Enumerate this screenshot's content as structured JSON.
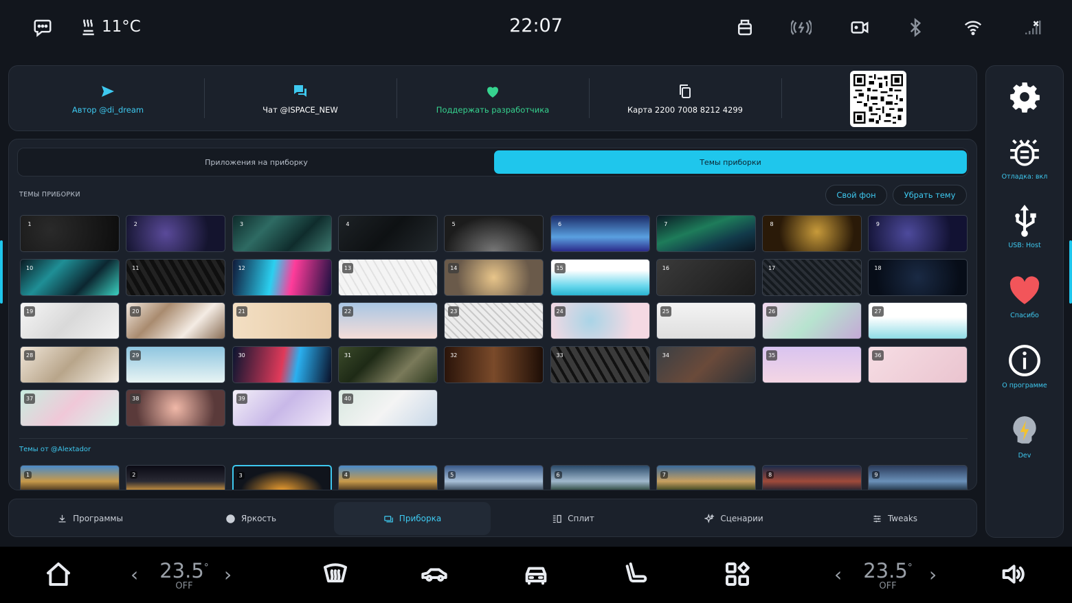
{
  "status_bar": {
    "temperature": "11°C",
    "time": "22:07"
  },
  "info_bar": {
    "author": "Автор @di_dream",
    "chat": "Чат @ISPACE_NEW",
    "support": "Поддержать разработчика",
    "card": "Карта 2200 7008 8212 4299",
    "colors": {
      "author": "#3ec9f0",
      "chat": "#ffffff",
      "support": "#36d38f",
      "card": "#ffffff"
    }
  },
  "segmented": {
    "apps_label": "Приложения на приборку",
    "themes_label": "Темы приборки",
    "active": "themes"
  },
  "themes": {
    "heading": "ТЕМЫ ПРИБОРКИ",
    "own_bg_label": "Свой фон",
    "remove_label": "Убрать тему",
    "tiles": [
      "1",
      "2",
      "3",
      "4",
      "5",
      "6",
      "7",
      "8",
      "9",
      "10",
      "11",
      "12",
      "13",
      "14",
      "15",
      "16",
      "17",
      "18",
      "19",
      "20",
      "21",
      "22",
      "23",
      "24",
      "25",
      "26",
      "27",
      "28",
      "29",
      "30",
      "31",
      "32",
      "33",
      "34",
      "35",
      "36",
      "37",
      "38",
      "39",
      "40"
    ]
  },
  "alexador": {
    "heading": "Темы от @Alextador",
    "tiles": [
      "1",
      "2",
      "3",
      "4",
      "5",
      "6",
      "7",
      "8",
      "9"
    ],
    "selected": "3"
  },
  "tabs": [
    {
      "label": "Программы",
      "icon": "download-icon"
    },
    {
      "label": "Яркость",
      "icon": "circle-icon"
    },
    {
      "label": "Приборка",
      "icon": "dashboard-icon",
      "active": true
    },
    {
      "label": "Сплит",
      "icon": "split-icon"
    },
    {
      "label": "Сценарии",
      "icon": "sparkle-icon"
    },
    {
      "label": "Tweaks",
      "icon": "sliders-icon"
    }
  ],
  "sidebar": {
    "debug": "Отладка: вкл",
    "usb": "USB: Host",
    "thanks": "Спасибо",
    "about": "О программе",
    "dev": "Dev"
  },
  "car_bar": {
    "left_temp": "23.5",
    "left_unit": "°",
    "left_state": "OFF",
    "right_temp": "23.5",
    "right_unit": "°",
    "right_state": "OFF"
  },
  "colors": {
    "accent": "#1fc6ec",
    "heart": "#f2555a"
  }
}
